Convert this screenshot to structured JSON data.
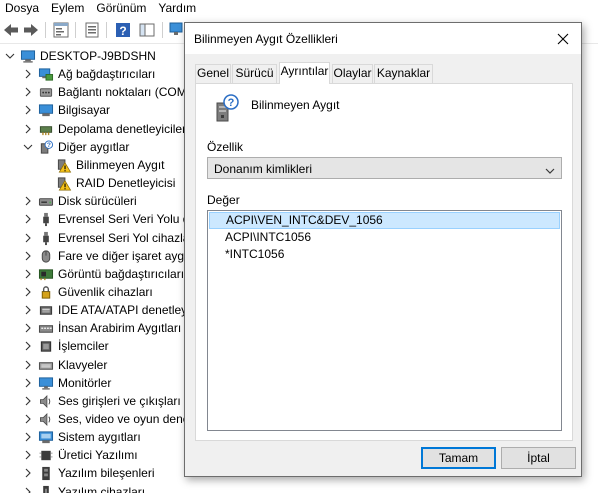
{
  "menubar": {
    "items": [
      "Dosya",
      "Eylem",
      "Görünüm",
      "Yardım"
    ]
  },
  "toolbar": {
    "icons": [
      "back-arrow-icon",
      "forward-arrow-icon",
      "properties-icon",
      "properties-sheet-icon",
      "help-icon",
      "view-icon",
      "scan-hardware-icon"
    ]
  },
  "tree": {
    "root": "DESKTOP-J9BDSHN",
    "items": [
      {
        "label": "Ağ bağdaştırıcıları",
        "icon": "network-adapter-icon"
      },
      {
        "label": "Bağlantı noktaları (COM",
        "icon": "port-icon"
      },
      {
        "label": "Bilgisayar",
        "icon": "computer-icon"
      },
      {
        "label": "Depolama denetleyiciler",
        "icon": "storage-controller-icon"
      },
      {
        "label": "Diğer aygıtlar",
        "icon": "other-devices-icon"
      },
      {
        "label": "Bilinmeyen Aygıt",
        "icon": "warning-device-icon"
      },
      {
        "label": "RAID Denetleyicisi",
        "icon": "warning-device-icon"
      },
      {
        "label": "Disk sürücüleri",
        "icon": "disk-drive-icon"
      },
      {
        "label": "Evrensel Seri Veri Yolu de",
        "icon": "usb-icon"
      },
      {
        "label": "Evrensel Seri Yol cihazları",
        "icon": "usb-icon"
      },
      {
        "label": "Fare ve diğer işaret aygıt",
        "icon": "mouse-icon"
      },
      {
        "label": "Görüntü bağdaştırıcıları",
        "icon": "display-adapter-icon"
      },
      {
        "label": "Güvenlik cihazları",
        "icon": "security-device-icon"
      },
      {
        "label": "IDE ATA/ATAPI denetleyi",
        "icon": "ide-controller-icon"
      },
      {
        "label": "İnsan Arabirim Aygıtları",
        "icon": "hid-icon"
      },
      {
        "label": "İşlemciler",
        "icon": "processor-icon"
      },
      {
        "label": "Klavyeler",
        "icon": "keyboard-icon"
      },
      {
        "label": "Monitörler",
        "icon": "monitor-icon"
      },
      {
        "label": "Ses girişleri ve çıkışları",
        "icon": "speaker-icon"
      },
      {
        "label": "Ses, video ve oyun dene",
        "icon": "speaker-icon"
      },
      {
        "label": "Sistem aygıtları",
        "icon": "system-device-icon"
      },
      {
        "label": "Üretici Yazılımı",
        "icon": "firmware-icon"
      },
      {
        "label": "Yazılım bileşenleri",
        "icon": "software-component-icon"
      },
      {
        "label": "Yazılım cihazları",
        "icon": "software-device-icon"
      }
    ]
  },
  "dialog": {
    "title": "Bilinmeyen Aygıt Özellikleri",
    "tabs": [
      "Genel",
      "Sürücü",
      "Ayrıntılar",
      "Olaylar",
      "Kaynaklar"
    ],
    "active_tab": "Ayrıntılar",
    "device_name": "Bilinmeyen Aygıt",
    "property_label": "Özellik",
    "property_value": "Donanım kimlikleri",
    "value_label": "Değer",
    "values": [
      "ACPI\\VEN_INTC&DEV_1056",
      "ACPI\\INTC1056",
      "*INTC1056"
    ],
    "selected_value": "ACPI\\VEN_INTC&DEV_1056",
    "ok_label": "Tamam",
    "cancel_label": "İptal"
  },
  "colors": {
    "selection_bg": "#cce8ff",
    "selection_border": "#99d1ff",
    "default_button_border": "#0078d7",
    "warning_yellow": "#f5c21b"
  }
}
